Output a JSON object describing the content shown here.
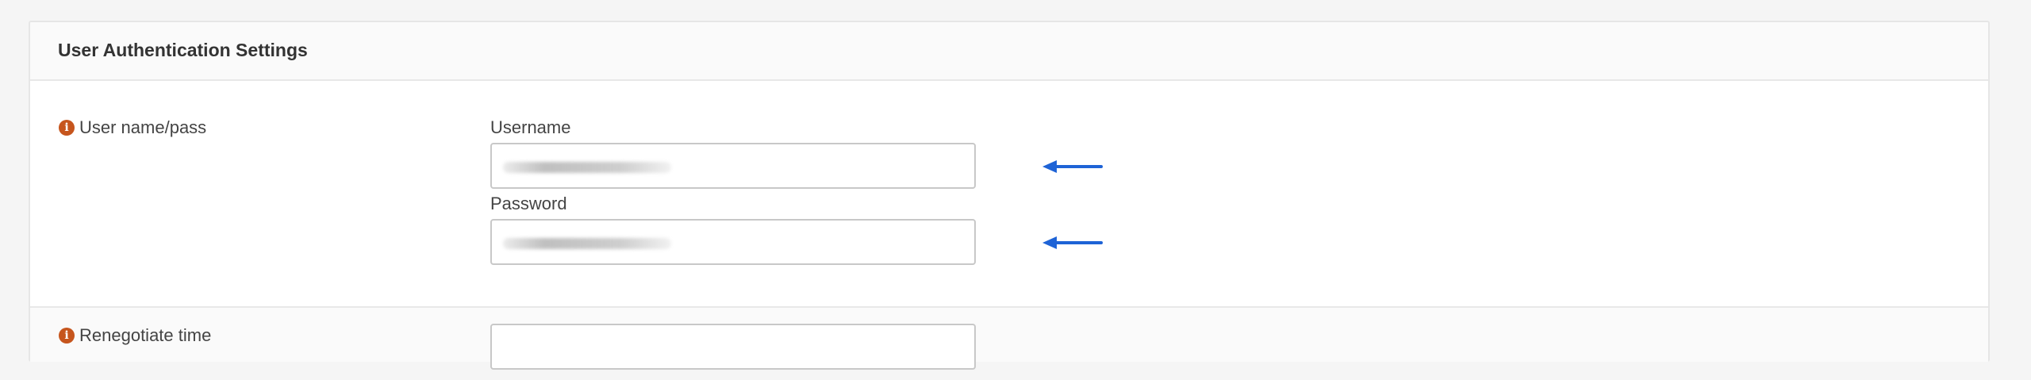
{
  "section": {
    "title": "User Authentication Settings"
  },
  "user_pass_row": {
    "label": "User name/pass",
    "username": {
      "label": "Username",
      "value": ""
    },
    "password": {
      "label": "Password",
      "value": ""
    }
  },
  "renegotiate_row": {
    "label": "Renegotiate time",
    "value": ""
  },
  "icons": {
    "info": "info-icon",
    "annotation": "arrow-left-icon"
  },
  "colors": {
    "info_icon": "#c6551d",
    "annotation_arrow": "#1e63d6"
  }
}
